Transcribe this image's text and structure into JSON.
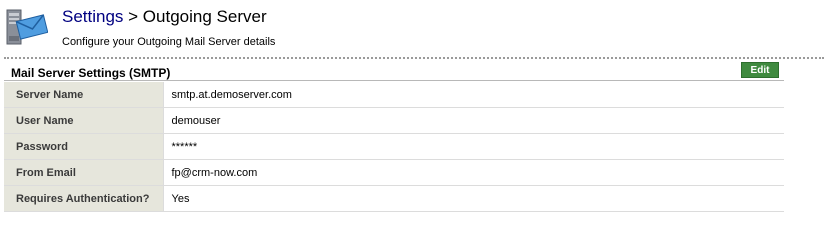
{
  "header": {
    "breadcrumb_link": "Settings",
    "breadcrumb_rest": " > Outgoing Server",
    "subtitle": "Configure your Outgoing Mail Server details"
  },
  "section": {
    "title": "Mail Server Settings (SMTP)",
    "edit_label": "Edit"
  },
  "rows": [
    {
      "label": "Server Name",
      "value": "smtp.at.demoserver.com"
    },
    {
      "label": "User Name",
      "value": "demouser"
    },
    {
      "label": "Password",
      "value": "******"
    },
    {
      "label": "From Email",
      "value": "fp@crm-now.com"
    },
    {
      "label": "Requires Authentication?",
      "value": "Yes"
    }
  ],
  "colors": {
    "breadcrumb_link": "#000080",
    "edit_button": "#3f8a3f",
    "label_background": "#e6e6dc"
  },
  "icons": {
    "header": "mail-server-icon"
  }
}
